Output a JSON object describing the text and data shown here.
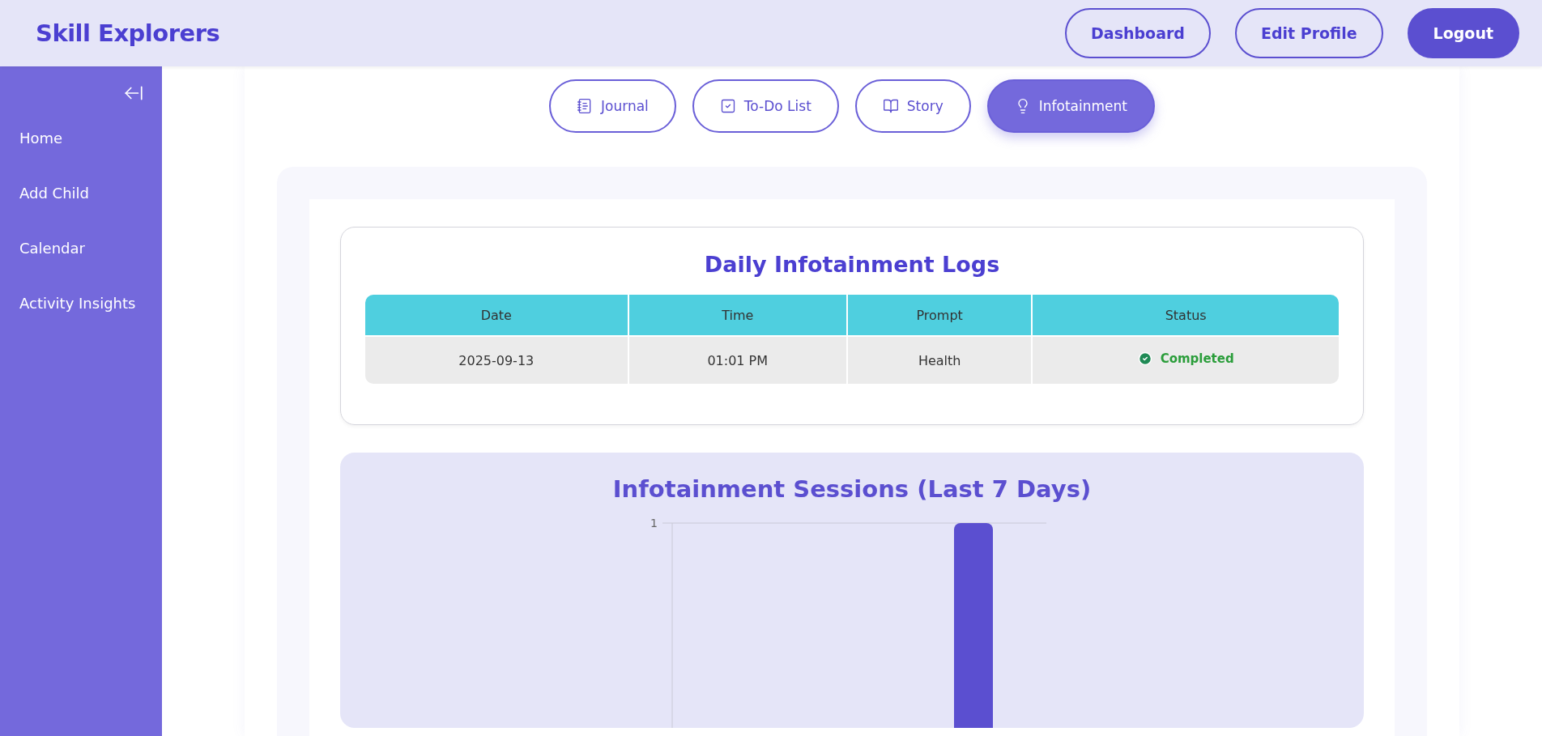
{
  "header": {
    "brand": "Skill Explorers",
    "buttons": [
      {
        "label": "Dashboard",
        "kind": "outline"
      },
      {
        "label": "Edit Profile",
        "kind": "outline"
      },
      {
        "label": "Logout",
        "kind": "solid"
      }
    ]
  },
  "sidebar": {
    "items": [
      {
        "label": "Home"
      },
      {
        "label": "Add Child"
      },
      {
        "label": "Calendar"
      },
      {
        "label": "Activity Insights"
      }
    ]
  },
  "tabs": [
    {
      "label": "Journal",
      "selected": false
    },
    {
      "label": "To-Do List",
      "selected": false
    },
    {
      "label": "Story",
      "selected": false
    },
    {
      "label": "Infotainment",
      "selected": true
    }
  ],
  "logs": {
    "title": "Daily Infotainment Logs",
    "columns": [
      "Date",
      "Time",
      "Prompt",
      "Status"
    ],
    "rows": [
      {
        "date": "2025-09-13",
        "time": "01:01 PM",
        "prompt": "Health",
        "status": "Completed",
        "completed": true
      }
    ]
  },
  "chart": {
    "title": "Infotainment Sessions (Last 7 Days)",
    "y_tick": "1"
  }
}
